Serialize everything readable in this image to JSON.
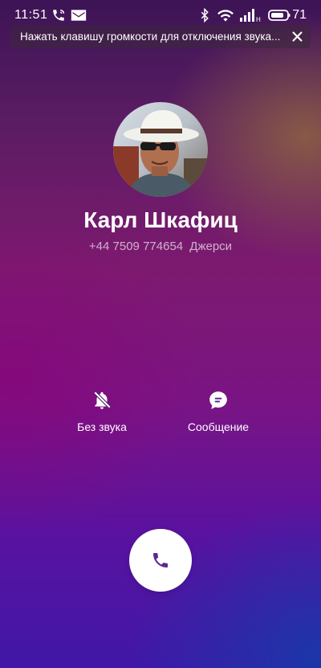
{
  "status_bar": {
    "time": "11:51",
    "battery": "71",
    "icons": [
      "phone-call-icon",
      "mail-icon",
      "bluetooth-icon",
      "wifi-icon",
      "signal-icon",
      "battery-icon"
    ]
  },
  "notification": {
    "text": "Нажать клавишу громкости для отключения звука...",
    "close_icon": "close-icon"
  },
  "caller": {
    "name": "Карл Шкафиц",
    "phone": "+44 7509 774654",
    "location": "Джерси"
  },
  "actions": {
    "mute_label": "Без звука",
    "message_label": "Сообщение"
  },
  "colors": {
    "accent": "#5b2a8e",
    "background_top": "#3d1456",
    "background_bottom": "#4017a6"
  }
}
